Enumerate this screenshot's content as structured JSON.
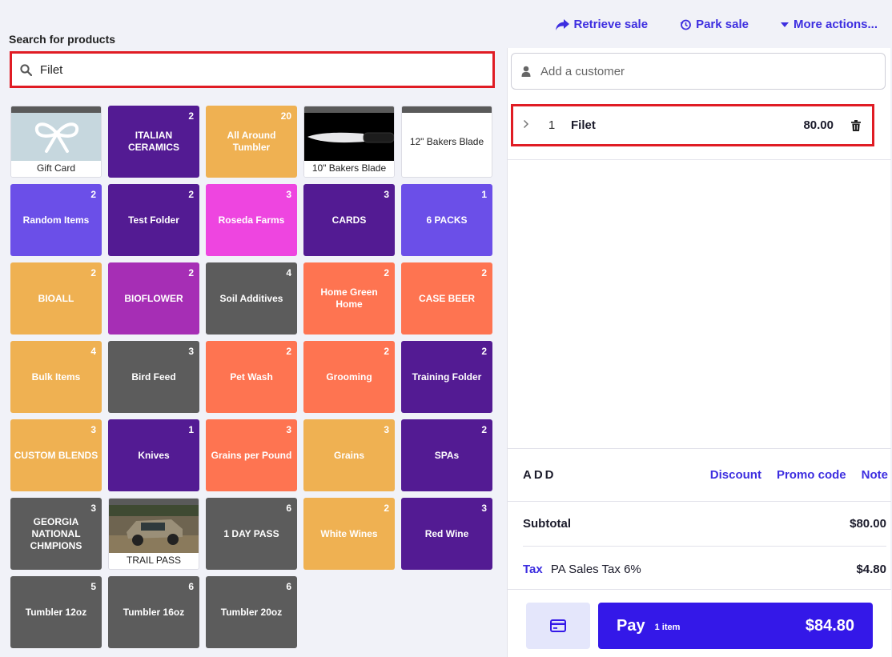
{
  "header": {
    "retrieve_sale": "Retrieve sale",
    "park_sale": "Park sale",
    "more_actions": "More actions..."
  },
  "search": {
    "label": "Search for products",
    "value": "Filet",
    "icon": "search-icon"
  },
  "tiles": [
    {
      "label": "Gift Card",
      "count": "",
      "kind": "image",
      "picture": "gift-ribbon"
    },
    {
      "label": "ITALIAN CERAMICS",
      "count": "2",
      "color": "#531b93"
    },
    {
      "label": "All Around Tumbler",
      "count": "20",
      "color": "#efb152"
    },
    {
      "label": "10\" Bakers Blade",
      "count": "",
      "kind": "image",
      "picture": "knife"
    },
    {
      "label": "12\" Bakers Blade",
      "count": "",
      "kind": "white"
    },
    {
      "label": "Random Items",
      "count": "2",
      "color": "#6b4fe8"
    },
    {
      "label": "Test Folder",
      "count": "2",
      "color": "#531b93"
    },
    {
      "label": "Roseda Farms",
      "count": "3",
      "color": "#ee45e0"
    },
    {
      "label": "CARDS",
      "count": "3",
      "color": "#531b93"
    },
    {
      "label": "6 PACKS",
      "count": "1",
      "color": "#6b4fe8"
    },
    {
      "label": "BIOALL",
      "count": "2",
      "color": "#efb152"
    },
    {
      "label": "BIOFLOWER",
      "count": "2",
      "color": "#a62eb5"
    },
    {
      "label": "Soil Additives",
      "count": "4",
      "color": "#5c5c5c"
    },
    {
      "label": "Home Green Home",
      "count": "2",
      "color": "#fe7451"
    },
    {
      "label": "CASE BEER",
      "count": "2",
      "color": "#fe7451"
    },
    {
      "label": "Bulk Items",
      "count": "4",
      "color": "#efb152"
    },
    {
      "label": "Bird Feed",
      "count": "3",
      "color": "#5c5c5c"
    },
    {
      "label": "Pet Wash",
      "count": "2",
      "color": "#fe7451"
    },
    {
      "label": "Grooming",
      "count": "2",
      "color": "#fe7451"
    },
    {
      "label": "Training Folder",
      "count": "2",
      "color": "#531b93"
    },
    {
      "label": "CUSTOM BLENDS",
      "count": "3",
      "color": "#efb152"
    },
    {
      "label": "Knives",
      "count": "1",
      "color": "#531b93"
    },
    {
      "label": "Grains per Pound",
      "count": "3",
      "color": "#fe7451"
    },
    {
      "label": "Grains",
      "count": "3",
      "color": "#efb152"
    },
    {
      "label": "SPAs",
      "count": "2",
      "color": "#531b93"
    },
    {
      "label": "GEORGIA NATIONAL CHMPIONS",
      "count": "3",
      "color": "#5c5c5c"
    },
    {
      "label": "TRAIL PASS",
      "count": "",
      "kind": "image",
      "picture": "jeep-mud"
    },
    {
      "label": "1 DAY PASS",
      "count": "6",
      "color": "#5c5c5c"
    },
    {
      "label": "White Wines",
      "count": "2",
      "color": "#efb152"
    },
    {
      "label": "Red Wine",
      "count": "3",
      "color": "#531b93"
    },
    {
      "label": "Tumbler 12oz",
      "count": "5",
      "color": "#5c5c5c"
    },
    {
      "label": "Tumbler 16oz",
      "count": "6",
      "color": "#5c5c5c"
    },
    {
      "label": "Tumbler 20oz",
      "count": "6",
      "color": "#5c5c5c"
    }
  ],
  "cart": {
    "customer_placeholder": "Add a customer",
    "line_item": {
      "qty": "1",
      "name": "Filet",
      "price": "80.00"
    },
    "add_title": "ADD",
    "discount": "Discount",
    "promo_code": "Promo code",
    "note": "Note",
    "subtotal_label": "Subtotal",
    "subtotal_value": "$80.00",
    "tax_link": "Tax",
    "tax_name": "PA Sales Tax 6%",
    "tax_value": "$4.80",
    "pay_label": "Pay",
    "pay_items": "1 item",
    "pay_total": "$84.80"
  },
  "colors": {
    "accent": "#3d2ee0",
    "pay_button": "#3418e8",
    "highlight": "#e01c24"
  }
}
